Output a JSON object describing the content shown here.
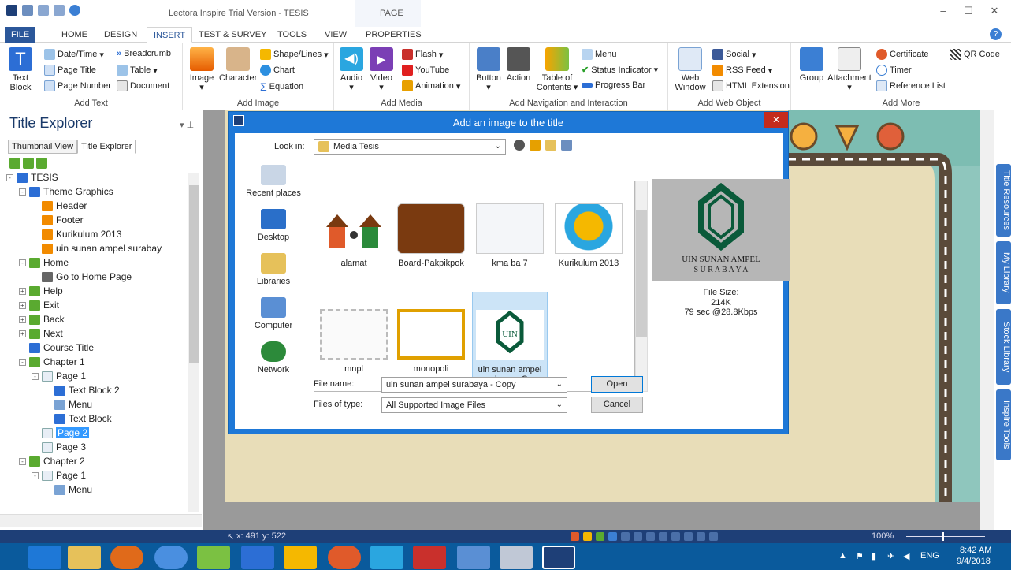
{
  "window": {
    "title": "Lectora Inspire Trial Version - TESIS",
    "context_tab": "PAGE"
  },
  "menu_tabs": [
    "FILE",
    "HOME",
    "DESIGN",
    "INSERT",
    "TEST & SURVEY",
    "TOOLS",
    "VIEW",
    "PROPERTIES"
  ],
  "ribbon": {
    "add_text": {
      "label": "Add Text",
      "text_block": "Text Block",
      "date_time": "Date/Time",
      "breadcrumb": "Breadcrumb",
      "page_title": "Page Title",
      "table": "Table",
      "page_number": "Page Number",
      "document": "Document"
    },
    "add_image": {
      "label": "Add Image",
      "image": "Image",
      "character": "Character",
      "shape_lines": "Shape/Lines",
      "chart": "Chart",
      "equation": "Equation"
    },
    "add_media": {
      "label": "Add Media",
      "audio": "Audio",
      "video": "Video",
      "flash": "Flash",
      "youtube": "YouTube",
      "animation": "Animation"
    },
    "add_nav": {
      "label": "Add Navigation and Interaction",
      "button": "Button",
      "action": "Action",
      "toc": "Table of Contents",
      "menu": "Menu",
      "status_indicator": "Status Indicator",
      "progress_bar": "Progress Bar"
    },
    "add_web": {
      "label": "Add Web Object",
      "web_window": "Web Window",
      "social": "Social",
      "rss": "RSS Feed",
      "html_ext": "HTML Extension"
    },
    "add_more": {
      "label": "Add More",
      "group": "Group",
      "attachment": "Attachment",
      "certificate": "Certificate",
      "timer": "Timer",
      "reference_list": "Reference List",
      "qr_code": "QR Code"
    }
  },
  "left_panel": {
    "title": "Title Explorer",
    "tabs": [
      "Thumbnail View",
      "Title Explorer"
    ],
    "tree": [
      {
        "label": "TESIS",
        "level": 0,
        "exp": "-",
        "icon": "title"
      },
      {
        "label": "Theme Graphics",
        "level": 1,
        "exp": "-",
        "icon": "folder"
      },
      {
        "label": "Header",
        "level": 2,
        "exp": "",
        "icon": "img"
      },
      {
        "label": "Footer",
        "level": 2,
        "exp": "",
        "icon": "img"
      },
      {
        "label": "Kurikulum 2013",
        "level": 2,
        "exp": "",
        "icon": "img"
      },
      {
        "label": "uin sunan ampel surabay",
        "level": 2,
        "exp": "",
        "icon": "img"
      },
      {
        "label": "Home",
        "level": 1,
        "exp": "-",
        "icon": "btn"
      },
      {
        "label": "Go to Home Page",
        "level": 2,
        "exp": "",
        "icon": "act"
      },
      {
        "label": "Help",
        "level": 1,
        "exp": "+",
        "icon": "btn"
      },
      {
        "label": "Exit",
        "level": 1,
        "exp": "+",
        "icon": "btn"
      },
      {
        "label": "Back",
        "level": 1,
        "exp": "+",
        "icon": "btn"
      },
      {
        "label": "Next",
        "level": 1,
        "exp": "+",
        "icon": "btn"
      },
      {
        "label": "Course Title",
        "level": 1,
        "exp": "",
        "icon": "text"
      },
      {
        "label": "Chapter 1",
        "level": 1,
        "exp": "-",
        "icon": "chap"
      },
      {
        "label": "Page 1",
        "level": 2,
        "exp": "-",
        "icon": "page"
      },
      {
        "label": "Text Block 2",
        "level": 3,
        "exp": "",
        "icon": "text"
      },
      {
        "label": "Menu",
        "level": 3,
        "exp": "",
        "icon": "menu"
      },
      {
        "label": "Text Block",
        "level": 3,
        "exp": "",
        "icon": "text"
      },
      {
        "label": "Page 2",
        "level": 2,
        "exp": "",
        "icon": "page",
        "selected": true
      },
      {
        "label": "Page 3",
        "level": 2,
        "exp": "",
        "icon": "page"
      },
      {
        "label": "Chapter 2",
        "level": 1,
        "exp": "-",
        "icon": "chap"
      },
      {
        "label": "Page 1",
        "level": 2,
        "exp": "-",
        "icon": "page"
      },
      {
        "label": "Menu",
        "level": 3,
        "exp": "",
        "icon": "menu"
      }
    ]
  },
  "side_tabs": [
    "Title Resources",
    "My Library",
    "Stock Library",
    "Inspire Tools"
  ],
  "dialog": {
    "title": "Add an image to the title",
    "look_in_label": "Look in:",
    "look_in_value": "Media Tesis",
    "places": [
      "Recent places",
      "Desktop",
      "Libraries",
      "Computer",
      "Network"
    ],
    "files": [
      {
        "name": "alamat"
      },
      {
        "name": "Board-Pakpikpok"
      },
      {
        "name": "kma ba 7"
      },
      {
        "name": "Kurikulum 2013"
      },
      {
        "name": "mnpl"
      },
      {
        "name": "monopoli"
      },
      {
        "name": "uin sunan ampel surabaya - Copy",
        "selected": true
      }
    ],
    "preview_text": {
      "line1": "UIN SUNAN AMPEL",
      "line2": "S U R A B A Y A"
    },
    "file_size_label": "File Size:",
    "file_size": "214K",
    "transfer": "79 sec @28.8Kbps",
    "file_name_label": "File name:",
    "file_name": "uin sunan ampel surabaya - Copy",
    "files_of_type_label": "Files of type:",
    "files_of_type": "All Supported Image Files",
    "open": "Open",
    "cancel": "Cancel"
  },
  "status": {
    "coords": "x: 491  y: 522",
    "zoom": "100%"
  },
  "tray": {
    "lang": "ENG",
    "time": "8:42 AM",
    "date": "9/4/2018"
  },
  "colors": {
    "accent": "#2b579a",
    "dialog": "#1e78d7",
    "status": "#1e3f77",
    "taskbar": "#0a5a9c"
  }
}
